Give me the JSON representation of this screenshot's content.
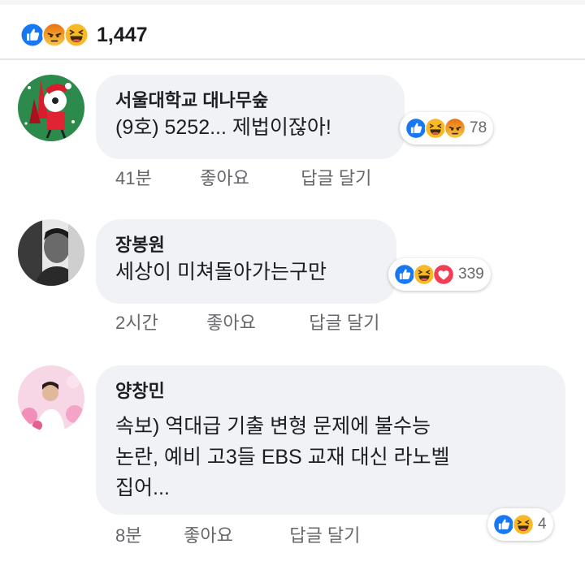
{
  "post": {
    "reactions": [
      "like-icon",
      "angry-icon",
      "haha-icon"
    ],
    "count": "1,447"
  },
  "comments": [
    {
      "author": "서울대학교 대나무숲",
      "lines": [
        "(9호) 5252... 제법이잖아!"
      ],
      "reactions": [
        "like-icon",
        "haha-icon",
        "angry-icon"
      ],
      "reaction_count": "78",
      "time": "41분",
      "like_label": "좋아요",
      "reply_label": "답글 달기"
    },
    {
      "author": "장봉원",
      "lines": [
        "세상이 미쳐돌아가는구만"
      ],
      "reactions": [
        "like-icon",
        "haha-icon",
        "love-icon"
      ],
      "reaction_count": "339",
      "time": "2시간",
      "like_label": "좋아요",
      "reply_label": "답글 달기"
    },
    {
      "author": "양창민",
      "lines": [
        "속보) 역대급 기출 변형 문제에 불수능",
        "논란, 예비 고3들 EBS 교재 대신 라노벨",
        "집어..."
      ],
      "reactions": [
        "like-icon",
        "haha-icon"
      ],
      "reaction_count": "4",
      "time": "8분",
      "like_label": "좋아요",
      "reply_label": "답글 달기"
    }
  ],
  "colors": {
    "like": "#1877f2",
    "haha": "#f7b928",
    "angry_top": "#e9710f",
    "love": "#f33e58",
    "bubble": "#f0f2f5",
    "meta_text": "#65676b"
  }
}
